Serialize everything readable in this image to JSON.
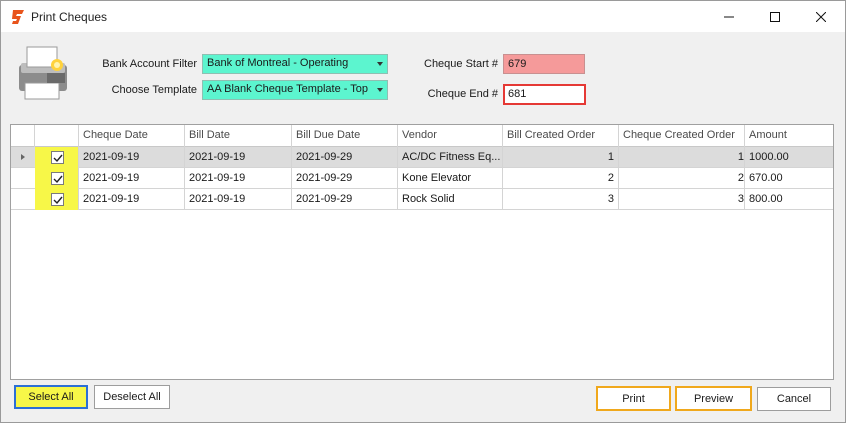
{
  "window": {
    "title": "Print Cheques",
    "controls": [
      "minimize",
      "maximize",
      "close"
    ]
  },
  "filters": {
    "bank_account_label": "Bank Account Filter",
    "bank_account_value": "Bank of Montreal - Operating",
    "template_label": "Choose Template",
    "template_value": "AA Blank Cheque Template - Top",
    "cheque_start_label": "Cheque Start #",
    "cheque_start_value": "679",
    "cheque_end_label": "Cheque End #",
    "cheque_end_value": "681"
  },
  "grid": {
    "columns": [
      "",
      "Cheque Date",
      "Bill Date",
      "Bill Due Date",
      "Vendor",
      "Bill Created Order",
      "Cheque Created Order",
      "Amount"
    ],
    "rows": [
      {
        "checked": true,
        "cheque_date": "2021-09-19",
        "bill_date": "2021-09-19",
        "bill_due_date": "2021-09-29",
        "vendor": "AC/DC Fitness Eq...",
        "bill_created_order": "1",
        "cheque_created_order": "1",
        "amount": "1000.00"
      },
      {
        "checked": true,
        "cheque_date": "2021-09-19",
        "bill_date": "2021-09-19",
        "bill_due_date": "2021-09-29",
        "vendor": "Kone Elevator",
        "bill_created_order": "2",
        "cheque_created_order": "2",
        "amount": "670.00"
      },
      {
        "checked": true,
        "cheque_date": "2021-09-19",
        "bill_date": "2021-09-19",
        "bill_due_date": "2021-09-29",
        "vendor": "Rock Solid",
        "bill_created_order": "3",
        "cheque_created_order": "3",
        "amount": "800.00"
      }
    ]
  },
  "buttons": {
    "select_all": "Select All",
    "deselect_all": "Deselect All",
    "print": "Print",
    "preview": "Preview",
    "cancel": "Cancel"
  },
  "colors": {
    "combo_bg": "#5cf5cf",
    "cheque_start_bg": "#f59a9a",
    "cheque_end_border": "#e53935",
    "checkbox_cell_bg": "#f7f748",
    "highlight_border": "#f0a81c",
    "select_all_border": "#2c6fd6"
  },
  "icons": {
    "app": "app-logo-icon",
    "printer": "printer-icon",
    "check": "checkmark-icon",
    "row_indicator": "row-indicator-icon"
  }
}
